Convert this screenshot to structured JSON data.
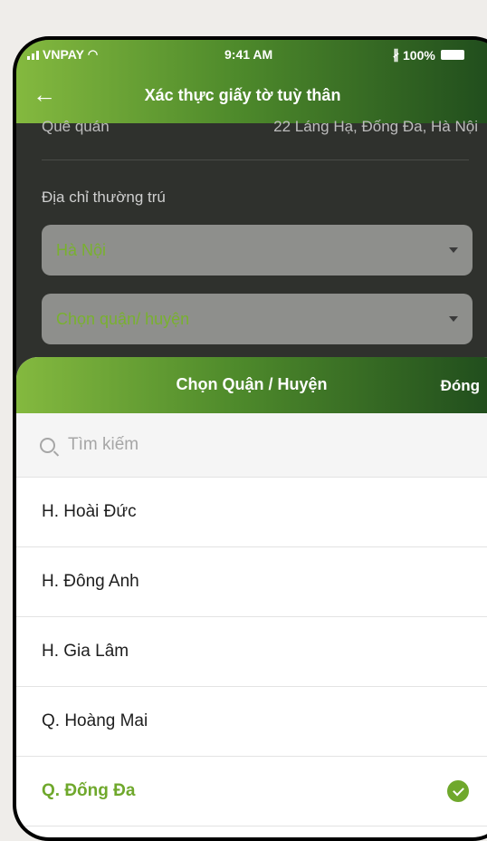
{
  "status_bar": {
    "carrier": "VNPAY",
    "time": "9:41 AM",
    "battery": "100%"
  },
  "header": {
    "title": "Xác thực giấy tờ tuỳ thân"
  },
  "form": {
    "hometown_label": "Quê quán",
    "hometown_value": "22 Láng Hạ, Đống Đa, Hà Nội",
    "address_label": "Địa chỉ thường trú",
    "city_value": "Hà Nội",
    "district_placeholder": "Chọn quận/ huyện"
  },
  "sheet": {
    "title": "Chọn Quận / Huyện",
    "close_label": "Đóng",
    "search_placeholder": "Tìm kiếm",
    "items": [
      {
        "label": "H. Hoài Đức",
        "selected": false
      },
      {
        "label": "H. Đông Anh",
        "selected": false
      },
      {
        "label": "H. Gia Lâm",
        "selected": false
      },
      {
        "label": "Q. Hoàng Mai",
        "selected": false
      },
      {
        "label": "Q. Đống Đa",
        "selected": true
      }
    ]
  },
  "colors": {
    "accent": "#6fa82c",
    "header_start": "#84b93f",
    "header_end": "#1e4a1c"
  }
}
